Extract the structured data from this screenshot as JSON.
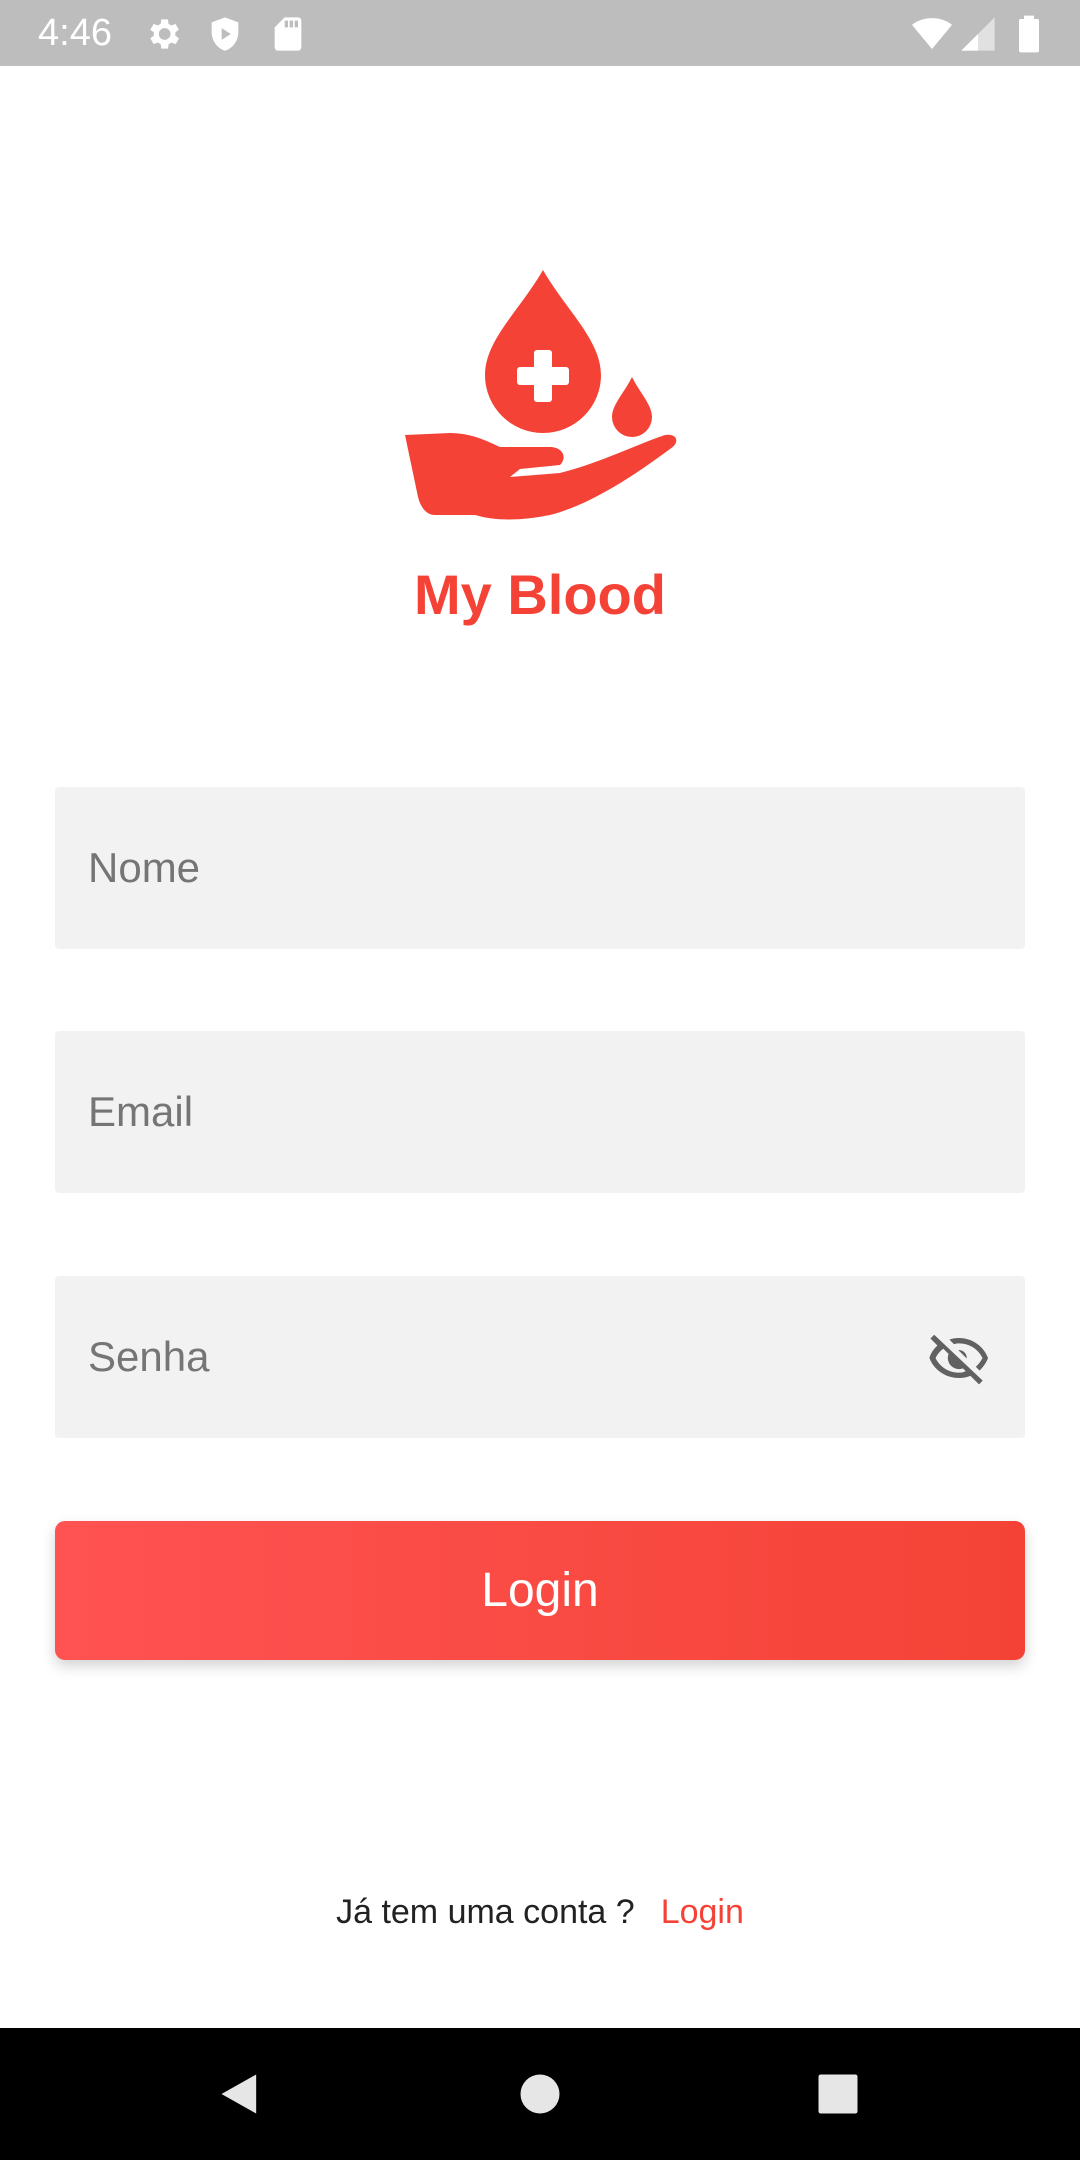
{
  "status_bar": {
    "time": "4:46",
    "icons": [
      "gear-icon",
      "shield-icon",
      "sd-card-icon",
      "wifi-icon",
      "signal-icon",
      "battery-icon"
    ]
  },
  "brand": {
    "name": "My Blood",
    "color": "#f44336"
  },
  "form": {
    "name_placeholder": "Nome",
    "email_placeholder": "Email",
    "password_placeholder": "Senha",
    "password_toggle_icon": "eye-off-icon",
    "login_label": "Login"
  },
  "footer": {
    "prompt": "Já tem uma conta ?",
    "link": "Login"
  },
  "nav_bar": {
    "icons": [
      "back-icon",
      "home-icon",
      "recents-icon"
    ]
  }
}
